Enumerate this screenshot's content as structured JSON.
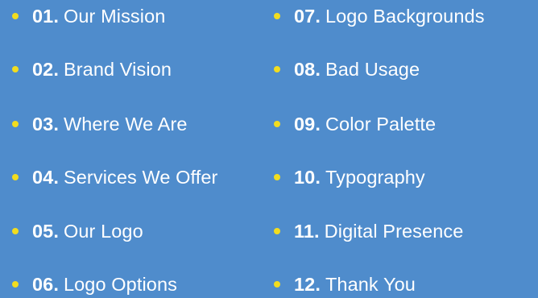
{
  "colors": {
    "background": "#4f8ccc",
    "text": "#ffffff",
    "bullet": "#f2dd1f"
  },
  "toc": {
    "left_column": [
      {
        "number": "01.",
        "label": "Our Mission"
      },
      {
        "number": "02.",
        "label": "Brand Vision"
      },
      {
        "number": "03.",
        "label": "Where We Are"
      },
      {
        "number": "04.",
        "label": "Services We Offer"
      },
      {
        "number": "05.",
        "label": "Our Logo"
      },
      {
        "number": "06.",
        "label": "Logo Options"
      }
    ],
    "right_column": [
      {
        "number": "07.",
        "label": "Logo Backgrounds"
      },
      {
        "number": "08.",
        "label": "Bad Usage"
      },
      {
        "number": "09.",
        "label": "Color Palette"
      },
      {
        "number": "10.",
        "label": "Typography"
      },
      {
        "number": "11.",
        "label": "Digital Presence"
      },
      {
        "number": "12.",
        "label": "Thank You"
      }
    ]
  }
}
